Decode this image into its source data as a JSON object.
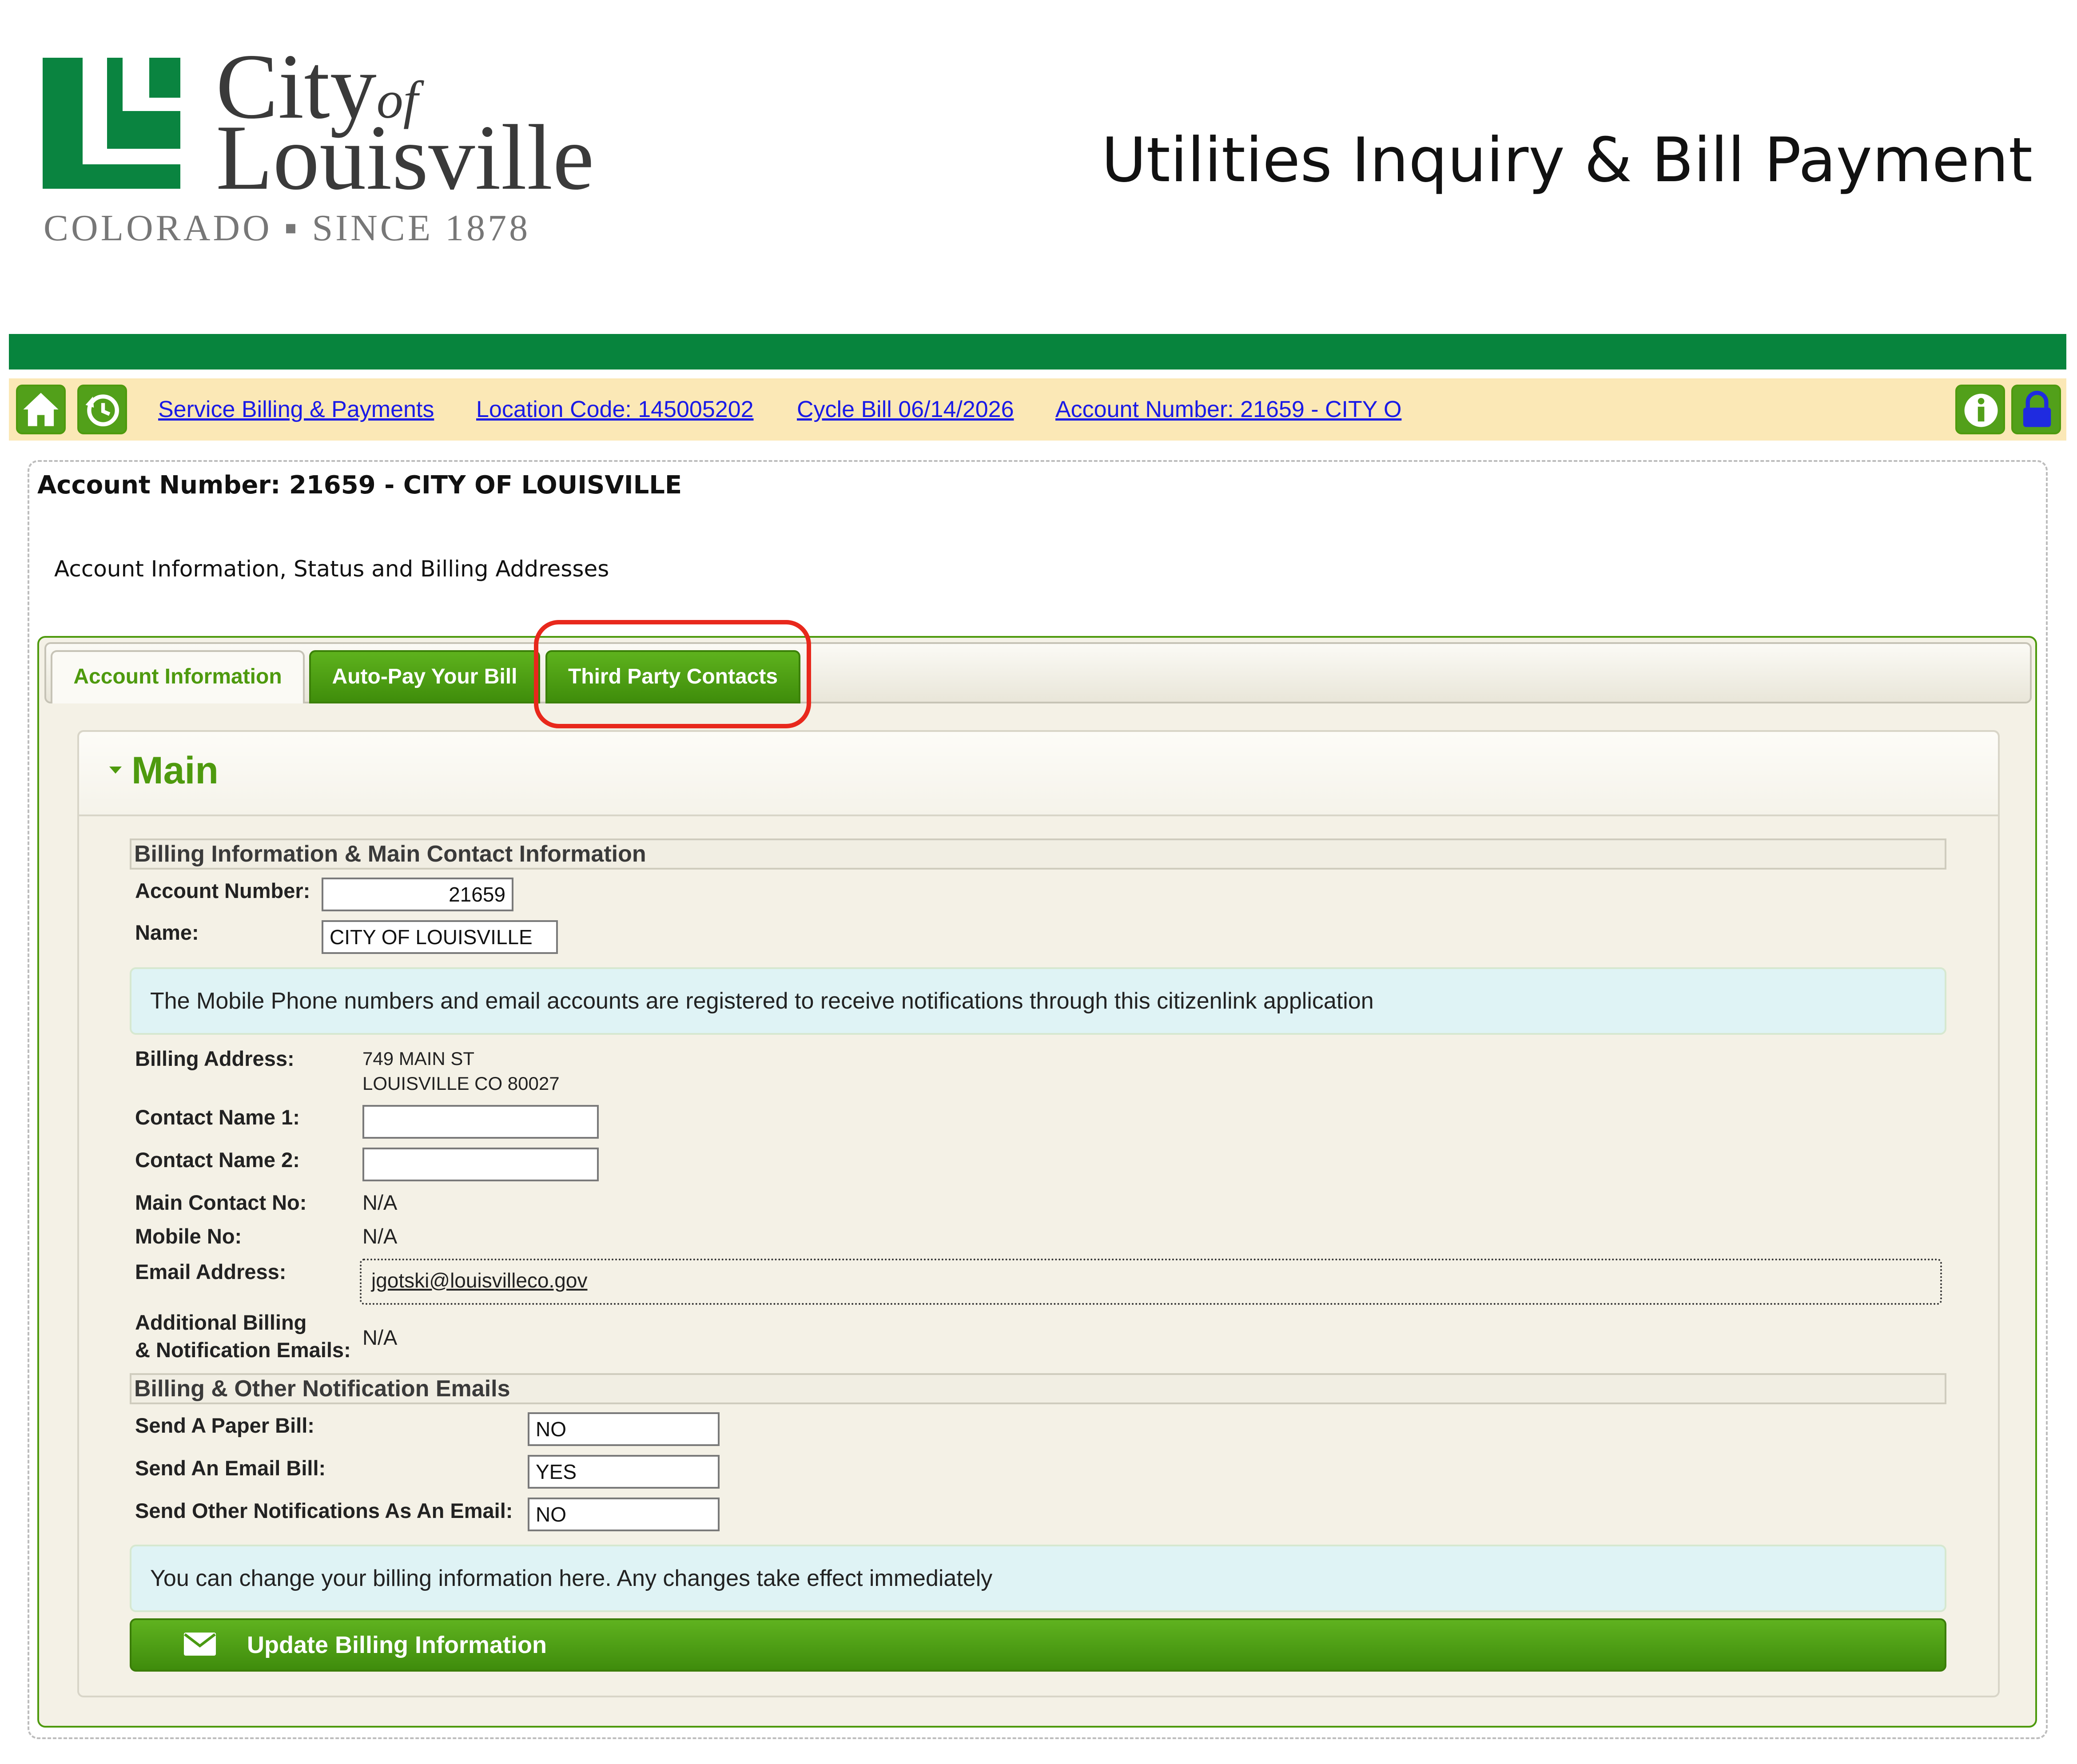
{
  "header": {
    "logo_city": "City",
    "logo_of": "of",
    "logo_louisville": "Louisville",
    "logo_tagline": "COLORADO ▪ SINCE 1878",
    "page_heading": "Utilities Inquiry & Bill Payment",
    "brand_color": "#07843d"
  },
  "nav": {
    "home_icon": "home-icon",
    "history_icon": "history-icon",
    "links": [
      "Service Billing & Payments",
      "Location Code: 145005202",
      "Cycle Bill 06/14/2026",
      "Account Number: 21659 - CITY O"
    ],
    "info_icon": "info-icon",
    "lock_icon": "lock-icon"
  },
  "account": {
    "title": "Account Number: 21659 - CITY OF LOUISVILLE",
    "subtitle": "Account Information, Status and Billing Addresses"
  },
  "tabs": [
    {
      "label": "Account Information",
      "active": true
    },
    {
      "label": "Auto-Pay Your Bill",
      "active": false
    },
    {
      "label": "Third Party Contacts",
      "active": false,
      "highlighted": true
    }
  ],
  "main": {
    "title": "Main",
    "billing_section_title": "Billing Information & Main Contact Information",
    "account_number_label": "Account Number:",
    "account_number_value": "21659",
    "name_label": "Name:",
    "name_value": "CITY OF LOUISVILLE",
    "notice_registered": "The Mobile Phone numbers and email accounts are registered to receive notifications through this citizenlink application",
    "billing_address_label": "Billing Address:",
    "billing_address_line1": "749 MAIN ST",
    "billing_address_line2": "LOUISVILLE CO 80027",
    "contact_name_1_label": "Contact Name 1:",
    "contact_name_1_value": "",
    "contact_name_2_label": "Contact Name 2:",
    "contact_name_2_value": "",
    "main_contact_label": "Main Contact No:",
    "main_contact_value": "N/A",
    "mobile_label": "Mobile No:",
    "mobile_value": "N/A",
    "email_label": "Email Address:",
    "email_value": "jgotski@louisvilleco.gov",
    "additional_label_line1": "Additional Billing",
    "additional_label_line2": "& Notification Emails:",
    "additional_value": "N/A",
    "notification_section_title": "Billing & Other Notification Emails",
    "paper_bill_label": "Send A Paper Bill:",
    "paper_bill_value": "NO",
    "email_bill_label": "Send An Email Bill:",
    "email_bill_value": "YES",
    "other_notifications_label": "Send Other Notifications As An Email:",
    "other_notifications_value": "NO",
    "notice_change": "You can change your billing information here. Any changes take effect immediately",
    "update_button_label": "Update Billing Information",
    "update_button_icon": "envelope-icon"
  }
}
